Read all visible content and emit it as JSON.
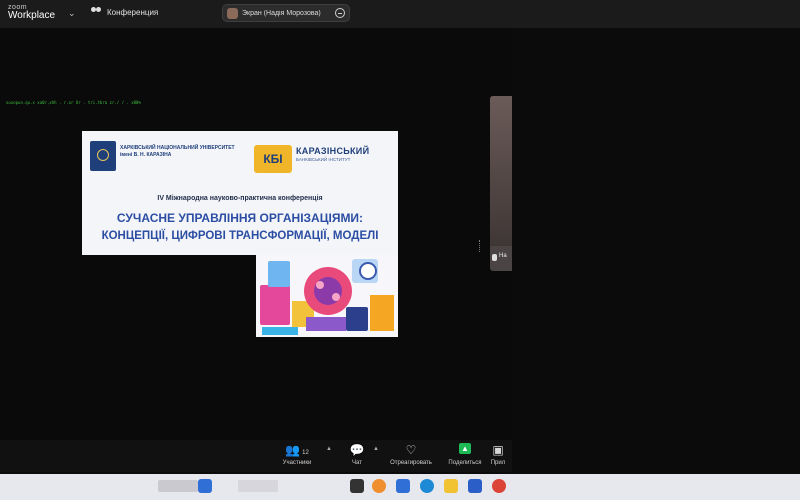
{
  "app": {
    "brand_small": "zoom",
    "brand_big": "Workplace",
    "conference_label": "Конференция",
    "screen_pill_text": "Экран (Надія Морозова)"
  },
  "terminal_line": "xuxopun.qu.s xa0r,xhh . r.xr Ur . tri.tbra zr./ / . x00%",
  "slide": {
    "university": "ХАРКІВСЬКИЙ НАЦІОНАЛЬНИЙ УНІВЕРСИТЕТ імені В. Н. КАРАЗІНА",
    "kbi_logo": "КБІ",
    "kbi_name": "КАРАЗІНСЬКИЙ",
    "kbi_sub": "БАНКІВСЬКИЙ ІНСТИТУТ",
    "conference_title": "IV Міжнародна науково-практична конференція",
    "headline_1": "СУЧАСНЕ УПРАВЛІННЯ ОРГАНІЗАЦІЯМИ:",
    "headline_2": "КОНЦЕПЦІЇ, ЦИФРОВІ ТРАНСФОРМАЦІЇ, МОДЕЛІ"
  },
  "video": {
    "name_label": "На"
  },
  "toolbar": {
    "participants_label": "Участники",
    "participants_count": "12",
    "chat_label": "Чат",
    "react_label": "Отреагировать",
    "share_label": "Поделиться",
    "more_label": "Прил"
  },
  "icons": {
    "participants": "people-icon",
    "chat": "chat-icon",
    "react": "heart-icon",
    "share": "share-screen-icon"
  },
  "colors": {
    "slide_blue": "#2b4da3",
    "kbi_orange": "#f1b52a",
    "share_green": "#1db954"
  }
}
